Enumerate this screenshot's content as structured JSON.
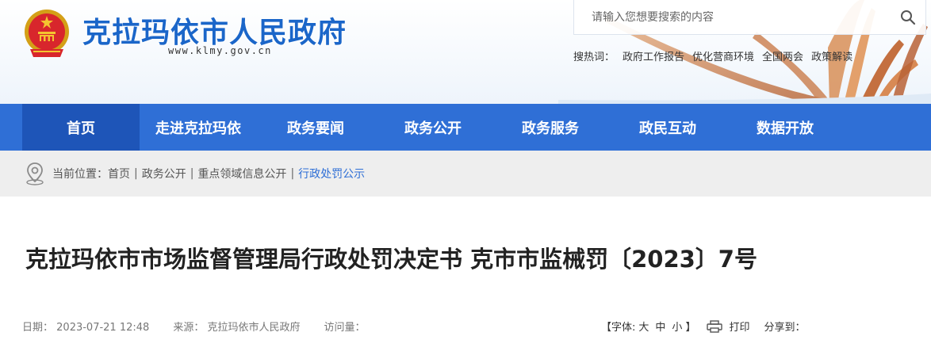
{
  "header": {
    "site_title": "克拉玛依市人民政府",
    "site_url": "www.klmy.gov.cn"
  },
  "search": {
    "placeholder": "请输入您想要搜索的内容"
  },
  "hot_search": {
    "label": "搜热词：",
    "items": [
      "政府工作报告",
      "优化营商环境",
      "全国两会",
      "政策解读"
    ]
  },
  "nav": {
    "items": [
      "首页",
      "走进克拉玛依",
      "政务要闻",
      "政务公开",
      "政务服务",
      "政民互动",
      "数据开放"
    ],
    "active_index": 0
  },
  "breadcrumb": {
    "label": "当前位置：",
    "items": [
      "首页",
      "政务公开",
      "重点领域信息公开",
      "行政处罚公示"
    ],
    "separator": "|"
  },
  "article": {
    "title": "克拉玛依市市场监督管理局行政处罚决定书 克市市监械罚〔2023〕7号",
    "date_label": "日期：",
    "date": "2023-07-21 12:48",
    "source_label": "来源：",
    "source": "克拉玛依市人民政府",
    "views_label": "访问量：",
    "font_label": "【字体:",
    "font_large": "大",
    "font_medium": "中",
    "font_small": "小",
    "font_close": "】",
    "print_label": "打印",
    "share_label": "分享到："
  },
  "colors": {
    "brand_blue": "#2f6fd6",
    "nav_active": "#1e55b8",
    "title_blue": "#1b66c9"
  }
}
